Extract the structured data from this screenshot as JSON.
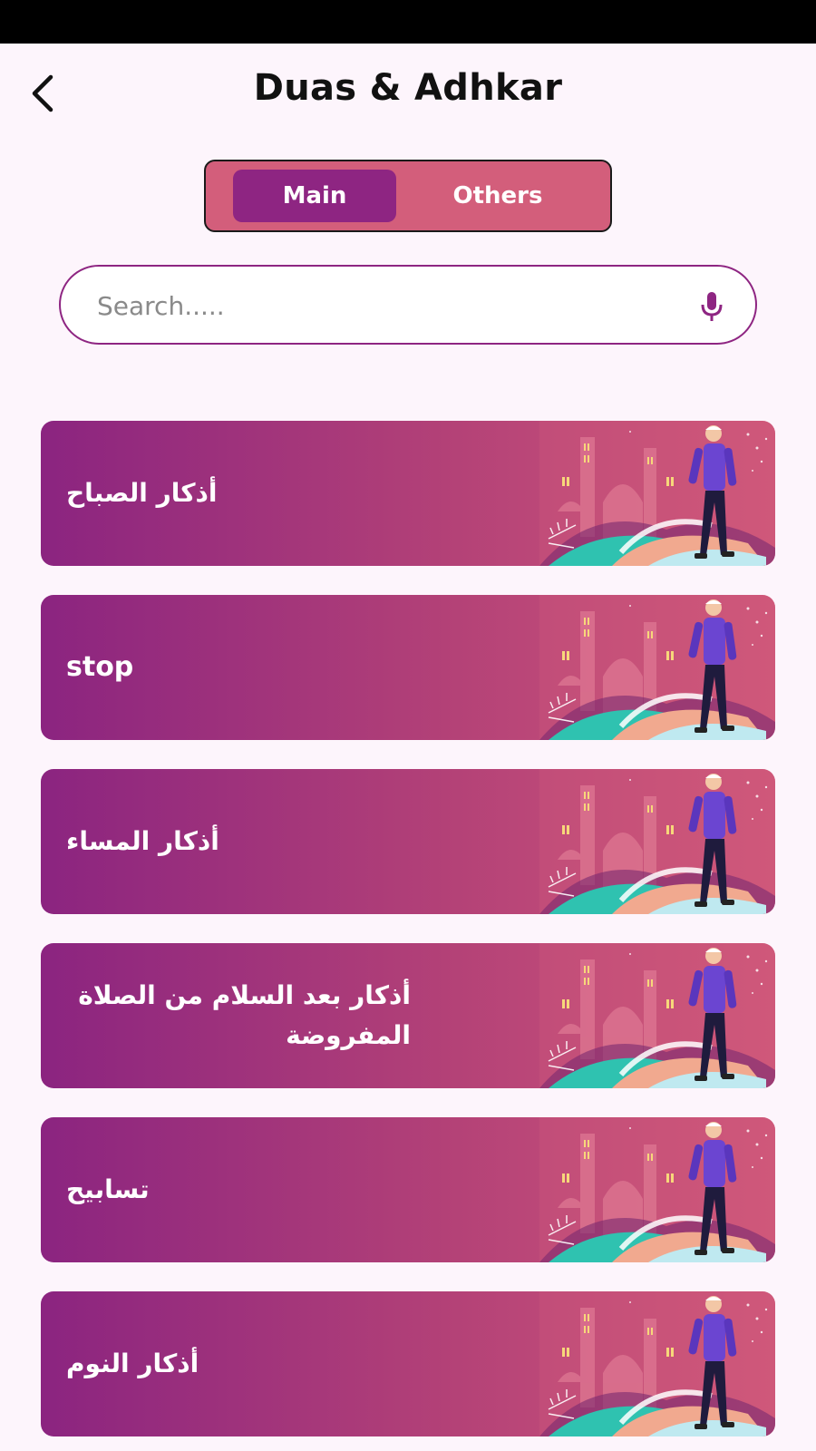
{
  "header": {
    "title": "Duas & Adhkar"
  },
  "tabs": [
    {
      "label": "Main",
      "active": true
    },
    {
      "label": "Others",
      "active": false
    }
  ],
  "search": {
    "placeholder": "Search.....",
    "value": ""
  },
  "items": [
    {
      "label": "أذكار الصباح"
    },
    {
      "label": "stop"
    },
    {
      "label": "أذكار المساء"
    },
    {
      "label": "أذكار بعد السلام من الصلاة المفروضة"
    },
    {
      "label": "تسابيح"
    },
    {
      "label": "أذكار النوم"
    }
  ],
  "icons": {
    "back": "chevron-left-icon",
    "mic": "microphone-icon"
  },
  "colors": {
    "background": "#fdf5fc",
    "accent": "#8e2582",
    "segment_bg": "#d35e7b",
    "card_start": "#8b2480",
    "card_end": "#d0587a"
  }
}
